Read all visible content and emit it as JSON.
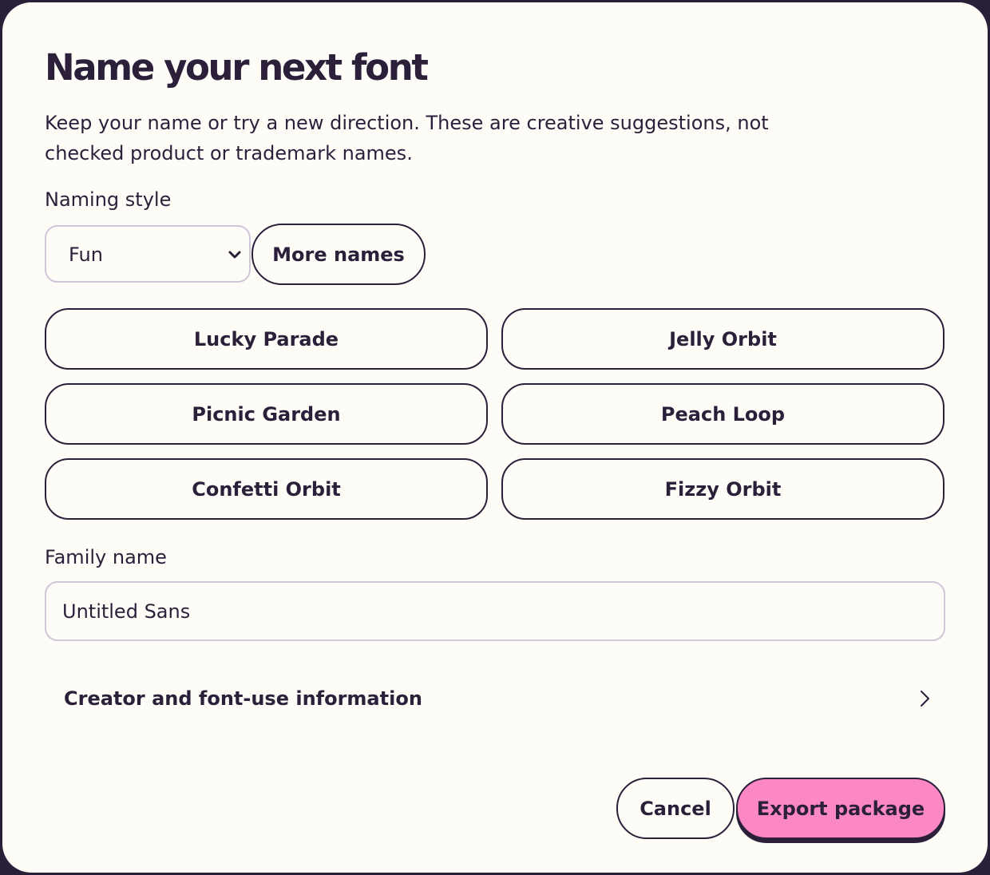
{
  "dialog": {
    "title": "Name your next font",
    "description": "Keep your name or try a new direction. These are creative suggestions, not checked product or trademark names."
  },
  "naming_style": {
    "label": "Naming style",
    "selected": "Fun",
    "more_names_label": "More names"
  },
  "suggestions": [
    "Lucky Parade",
    "Jelly Orbit",
    "Picnic Garden",
    "Peach Loop",
    "Confetti Orbit",
    "Fizzy Orbit"
  ],
  "family_name": {
    "label": "Family name",
    "value": "Untitled Sans"
  },
  "creator_info": {
    "label": "Creator and font-use information"
  },
  "actions": {
    "cancel_label": "Cancel",
    "export_label": "Export package"
  },
  "colors": {
    "background": "#fdfcf7",
    "text": "#2b1f3a",
    "accent": "#fb87c5",
    "field_border": "#cfc6da"
  },
  "icons": {
    "select": "chevron-down-icon",
    "disclosure": "chevron-right-icon"
  }
}
